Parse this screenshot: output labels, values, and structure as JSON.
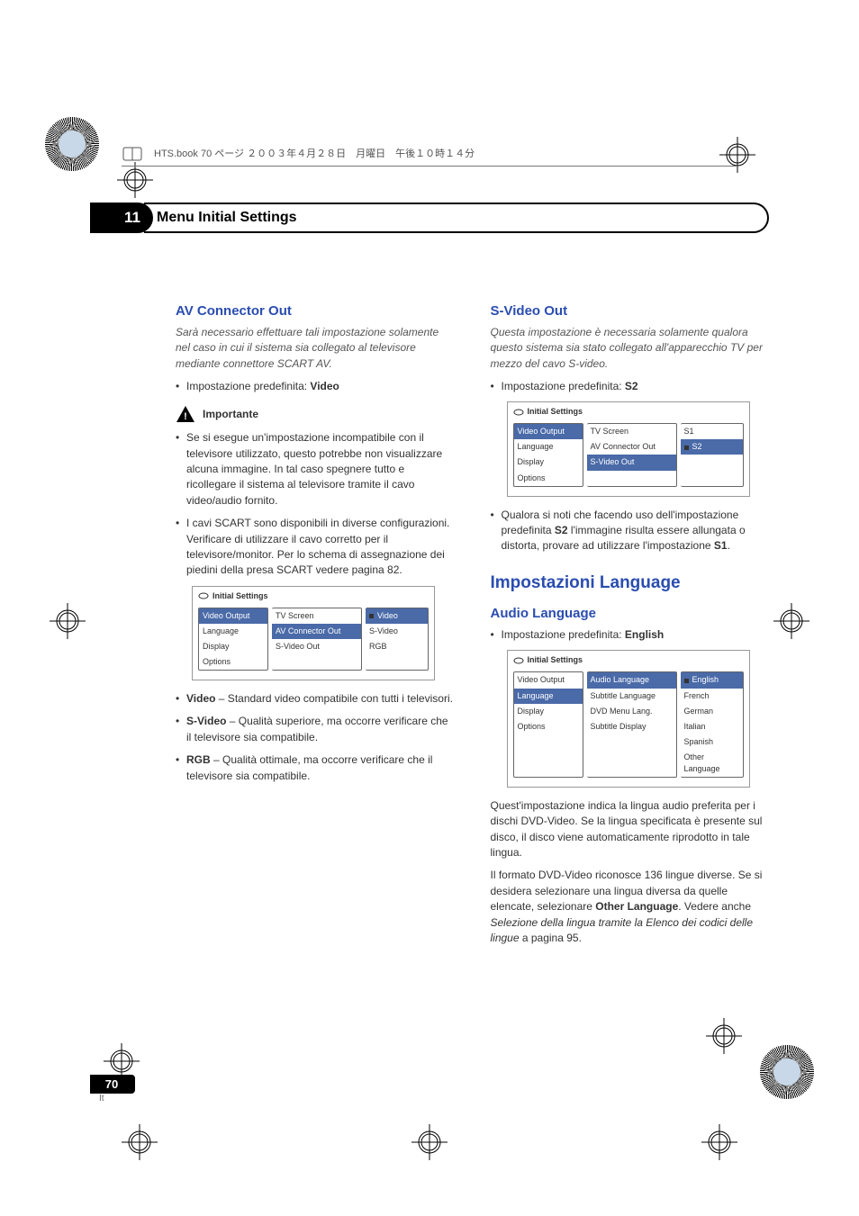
{
  "header_line": "HTS.book 70 ページ ２００３年４月２８日　月曜日　午後１０時１４分",
  "chapter": {
    "number": "11",
    "title": "Menu Initial Settings"
  },
  "left": {
    "h1": "AV Connector Out",
    "intro": "Sarà necessario effettuare tali impostazione solamente nel caso in cui il sistema sia collegato al televisore mediante connettore SCART AV.",
    "default_label": "Impostazione predefinita: ",
    "default_value": "Video",
    "important_label": "Importante",
    "bul1": "Se si esegue un'impostazione incompatibile con il televisore utilizzato, questo potrebbe non visualizzare alcuna immagine. In tal caso spegnere tutto e ricollegare il sistema al televisore tramite il cavo video/audio fornito.",
    "bul2": "I cavi SCART sono disponibili in diverse configurazioni. Verificare di utilizzare il cavo corretto per il televisore/monitor. Per lo schema di assegnazione dei piedini della presa SCART vedere pagina 82.",
    "opt1_b": "Video",
    "opt1_t": " – Standard video compatibile con tutti i televisori.",
    "opt2_b": "S-Video",
    "opt2_t": " – Qualità superiore, ma occorre verificare che il televisore sia compatibile.",
    "opt3_b": "RGB",
    "opt3_t": " – Qualità ottimale, ma occorre verificare che il televisore sia compatibile.",
    "menu": {
      "title": "Initial Settings",
      "col1": [
        "Video Output",
        "Language",
        "Display",
        "Options"
      ],
      "col2": [
        "TV Screen",
        "AV Connector Out",
        "S-Video Out"
      ],
      "col3": [
        "Video",
        "S-Video",
        "RGB"
      ],
      "sel_col2": 1,
      "sel_col3": 0
    }
  },
  "right": {
    "h1": "S-Video Out",
    "intro": "Questa impostazione è necessaria solamente qualora questo sistema sia stato collegato all'apparecchio TV per mezzo del cavo S-video.",
    "default_label": "Impostazione predefinita: ",
    "default_value": "S2",
    "menu1": {
      "title": "Initial Settings",
      "col1": [
        "Video Output",
        "Language",
        "Display",
        "Options"
      ],
      "col2": [
        "TV Screen",
        "AV Connector Out",
        "S-Video Out"
      ],
      "col3": [
        "S1",
        "S2"
      ],
      "sel_col2": 2,
      "sel_col3": 1
    },
    "bul1a": "Qualora si noti che facendo uso dell'impostazione predefinita ",
    "bul1b": "S2",
    "bul1c": " l'immagine risulta essere allungata o distorta, provare ad utilizzare l'impostazione ",
    "bul1d": "S1",
    "bul1e": ".",
    "h2": "Impostazioni Language",
    "h3": "Audio Language",
    "default2_label": "Impostazione predefinita: ",
    "default2_value": "English",
    "menu2": {
      "title": "Initial Settings",
      "col1": [
        "Video Output",
        "Language",
        "Display",
        "Options"
      ],
      "col2": [
        "Audio Language",
        "Subtitle Language",
        "DVD Menu Lang.",
        "Subtitle Display"
      ],
      "col3": [
        "English",
        "French",
        "German",
        "Italian",
        "Spanish",
        "Other Language"
      ],
      "sel_col2": 0,
      "sel_col3": 0
    },
    "p1": "Quest'impostazione indica la lingua audio preferita per i dischi DVD-Video. Se la lingua specificata è presente sul disco, il disco viene automaticamente riprodotto in tale lingua.",
    "p2a": "Il formato DVD-Video riconosce 136 lingue diverse. Se si desidera selezionare una lingua diversa da quelle elencate, selezionare ",
    "p2b": "Other Language",
    "p2c": ". Vedere anche ",
    "p2d": "Selezione della lingua tramite la Elenco dei codici delle lingue",
    "p2e": " a pagina 95."
  },
  "page": {
    "num": "70",
    "lang": "It"
  }
}
